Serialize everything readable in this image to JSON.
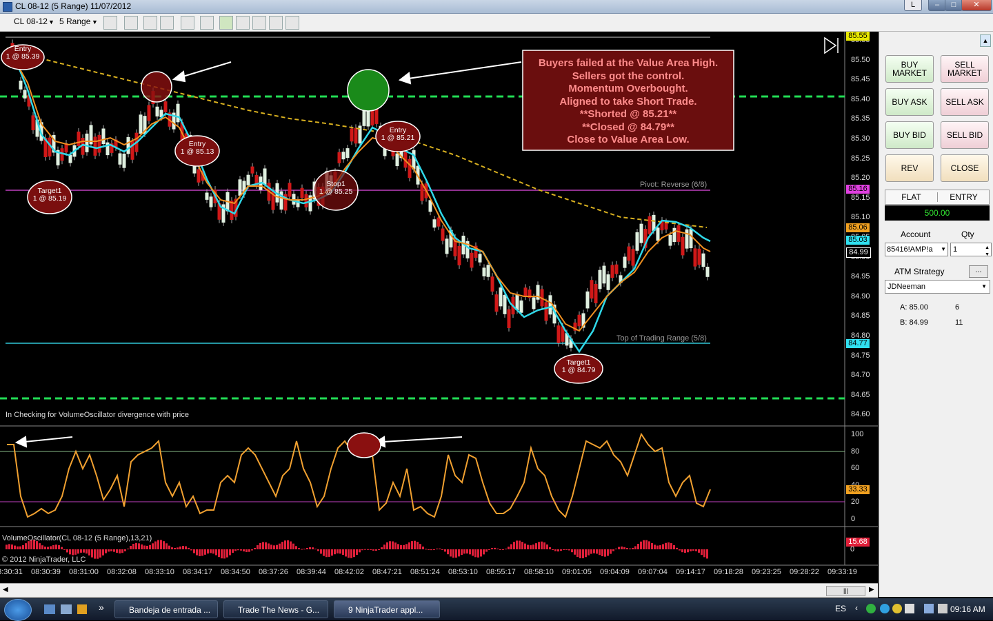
{
  "window": {
    "title": "CL 08-12 (5 Range)  11/07/2012",
    "minimize": "–",
    "maximize": "□",
    "close": "✕",
    "lang_btn": "L"
  },
  "toolbar": {
    "instrument": "CL 08-12",
    "period": "5 Range"
  },
  "price_axis": {
    "ticks": [
      "85.55",
      "85.50",
      "85.45",
      "85.40",
      "85.35",
      "85.30",
      "85.25",
      "85.20",
      "85.15",
      "85.10",
      "85.05",
      "85.00",
      "84.95",
      "84.90",
      "84.85",
      "84.80",
      "84.75",
      "84.70",
      "84.65",
      "84.60"
    ],
    "tags": [
      {
        "text": "85.55",
        "color": "#e8e800"
      },
      {
        "text": "85.16",
        "color": "#e040e0"
      },
      {
        "text": "85.06",
        "color": "#f0a020"
      },
      {
        "text": "85.03",
        "color": "#30e0f0"
      },
      {
        "text": "84.99",
        "color": "#000000"
      },
      {
        "text": "84.77",
        "color": "#30e0f0"
      }
    ]
  },
  "annotation": {
    "lines": [
      "Buyers failed at the Value Area High.",
      "Sellers got the control.",
      "Momentum Overbought.",
      "Aligned to take Short Trade.",
      "**Shorted @ 85.21**",
      "**Closed @ 84.79**",
      "Close to Value Area Low."
    ]
  },
  "markers": [
    {
      "l1": "Entry",
      "l2": "1 @ 85.39"
    },
    {
      "l1": "Target1",
      "l2": "1 @ 85.19"
    },
    {
      "l1": "Entry",
      "l2": "1 @ 85.13"
    },
    {
      "l1": "Stop1",
      "l2": "1 @ 85.25"
    },
    {
      "l1": "Entry",
      "l2": "1 @ 85.21"
    },
    {
      "l1": "Target1",
      "l2": "1 @ 84.79"
    }
  ],
  "line_labels": {
    "pivot": "Pivot: Reverse (6/8)",
    "trading_range": "Top of Trading Range (5/8)"
  },
  "indicator_note": "In  Checking for VolumeOscillator  divergence with price",
  "oscillator": {
    "ticks": [
      "100",
      "80",
      "60",
      "40",
      "20",
      "0"
    ],
    "value": "33.33"
  },
  "volume_osc": {
    "label": "VolumeOscillator(CL 08-12 (5 Range),13,21)",
    "value": "15.68",
    "zero": "0"
  },
  "copyright": "© 2012 NinjaTrader, LLC",
  "time_axis": [
    "08:30:31",
    "08:30:39",
    "08:31:00",
    "08:32:08",
    "08:33:10",
    "08:34:17",
    "08:34:50",
    "08:37:26",
    "08:39:44",
    "08:42:02",
    "08:47:21",
    "08:51:24",
    "08:53:10",
    "08:55:17",
    "08:58:10",
    "09:01:05",
    "09:04:09",
    "09:07:04",
    "09:14:17",
    "09:18:28",
    "09:23:25",
    "09:28:22",
    "09:33:19"
  ],
  "trade_panel": {
    "buy_market": "BUY MARKET",
    "sell_market": "SELL MARKET",
    "buy_ask": "BUY ASK",
    "sell_ask": "SELL ASK",
    "buy_bid": "BUY BID",
    "sell_bid": "SELL BID",
    "rev": "REV",
    "close": "CLOSE",
    "flat": "FLAT",
    "entry": "ENTRY",
    "pnl": "500.00",
    "account_label": "Account",
    "qty_label": "Qty",
    "account_value": "85416!AMP!a",
    "qty_value": "1",
    "atm_label": "ATM Strategy",
    "atm_btn": "...",
    "atm_value": "JDNeeman",
    "ask": "A: 85.00",
    "ask_size": "6",
    "bid": "B: 84.99",
    "bid_size": "11"
  },
  "taskbar": {
    "items": [
      "Bandeja de entrada ...",
      "Trade The News - G...",
      "9  NinjaTrader appl..."
    ],
    "lang": "ES",
    "clock": "09:16 AM",
    "more": "»"
  }
}
